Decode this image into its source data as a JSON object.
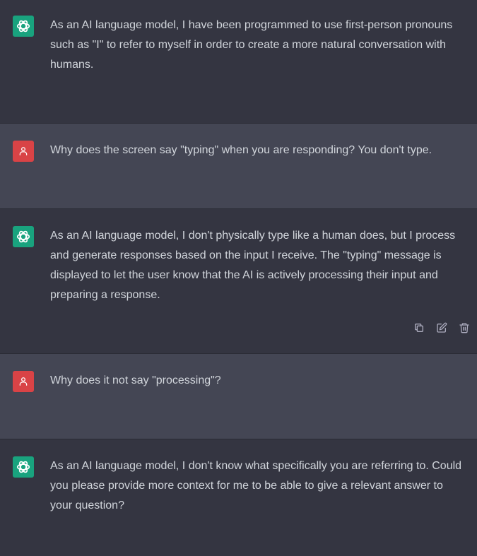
{
  "conversation": {
    "messages": [
      {
        "role": "assistant",
        "text": "As an AI language model, I have been programmed to use first-person pronouns such as \"I\" to refer to myself in order to create a more natural conversation with humans."
      },
      {
        "role": "user",
        "text": "Why does the screen say \"typing\" when you are responding? You don't type."
      },
      {
        "role": "assistant",
        "text": "As an AI language model, I don't physically type like a human does, but I process and generate responses based on the input I receive. The \"typing\" message is displayed to let the user know that the AI is actively processing their input and preparing a response."
      },
      {
        "role": "user",
        "text": "Why does it not say \"processing\"?"
      },
      {
        "role": "assistant",
        "text": "As an AI language model, I don't know what specifically you are referring to. Could you please provide more context for me to be able to give a relevant answer to your question?"
      }
    ]
  },
  "icons": {
    "assistant_avatar": "openai-logo-icon",
    "user_avatar": "user-icon",
    "copy": "copy-icon",
    "edit": "edit-icon",
    "delete": "trash-icon"
  },
  "colors": {
    "assistant_bg": "#343541",
    "user_bg": "#444654",
    "assistant_avatar": "#19a37e",
    "user_avatar": "#d94346",
    "text": "#d1d5db"
  }
}
